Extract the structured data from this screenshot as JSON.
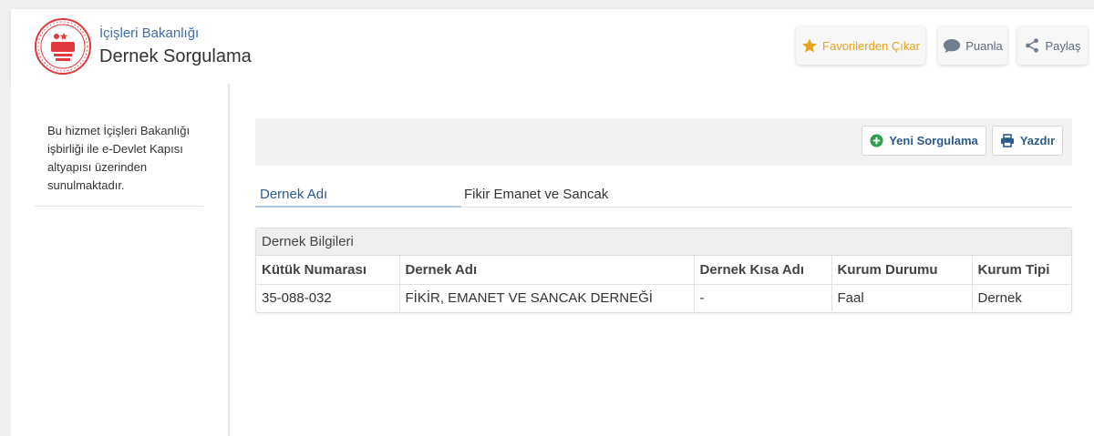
{
  "header": {
    "agency": "İçişleri Bakanlığı",
    "service_title": "Dernek Sorgulama",
    "buttons": {
      "favorite": "Favorilerden Çıkar",
      "rate": "Puanla",
      "share": "Paylaş"
    }
  },
  "sidebar": {
    "note": "Bu hizmet İçişleri Bakanlığı işbirliği ile e-Devlet Kapısı altyapısı üzerinden sunulmaktadır."
  },
  "toolbar": {
    "new_query": "Yeni Sorgulama",
    "print": "Yazdır"
  },
  "query": {
    "label": "Dernek Adı",
    "value": "Fikir Emanet ve Sancak"
  },
  "results": {
    "caption": "Dernek Bilgileri",
    "columns": [
      "Kütük Numarası",
      "Dernek Adı",
      "Dernek Kısa Adı",
      "Kurum Durumu",
      "Kurum Tipi"
    ],
    "rows": [
      [
        "35-088-032",
        "FİKİR, EMANET VE SANCAK DERNEĞİ",
        "-",
        "Faal",
        "Dernek"
      ]
    ]
  },
  "colors": {
    "accent_blue": "#2d5a8c",
    "star": "#e3a31a",
    "logo_red": "#e0393e",
    "plus_green": "#2e9e4f"
  }
}
